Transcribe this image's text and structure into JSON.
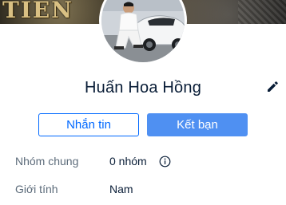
{
  "cover": {
    "text": "TIEN"
  },
  "profile": {
    "name": "Huấn Hoa Hồng",
    "edit_icon": "pencil-icon"
  },
  "actions": {
    "message_label": "Nhắn tin",
    "add_friend_label": "Kết bạn"
  },
  "info": {
    "groups_label": "Nhóm chung",
    "groups_value": "0 nhóm",
    "groups_icon": "info-icon",
    "gender_label": "Giới tính",
    "gender_value": "Nam"
  },
  "colors": {
    "primary": "#0068ff",
    "button_fill": "#4f90f2",
    "text_main": "#081c36",
    "text_muted": "#5c6b7a"
  }
}
